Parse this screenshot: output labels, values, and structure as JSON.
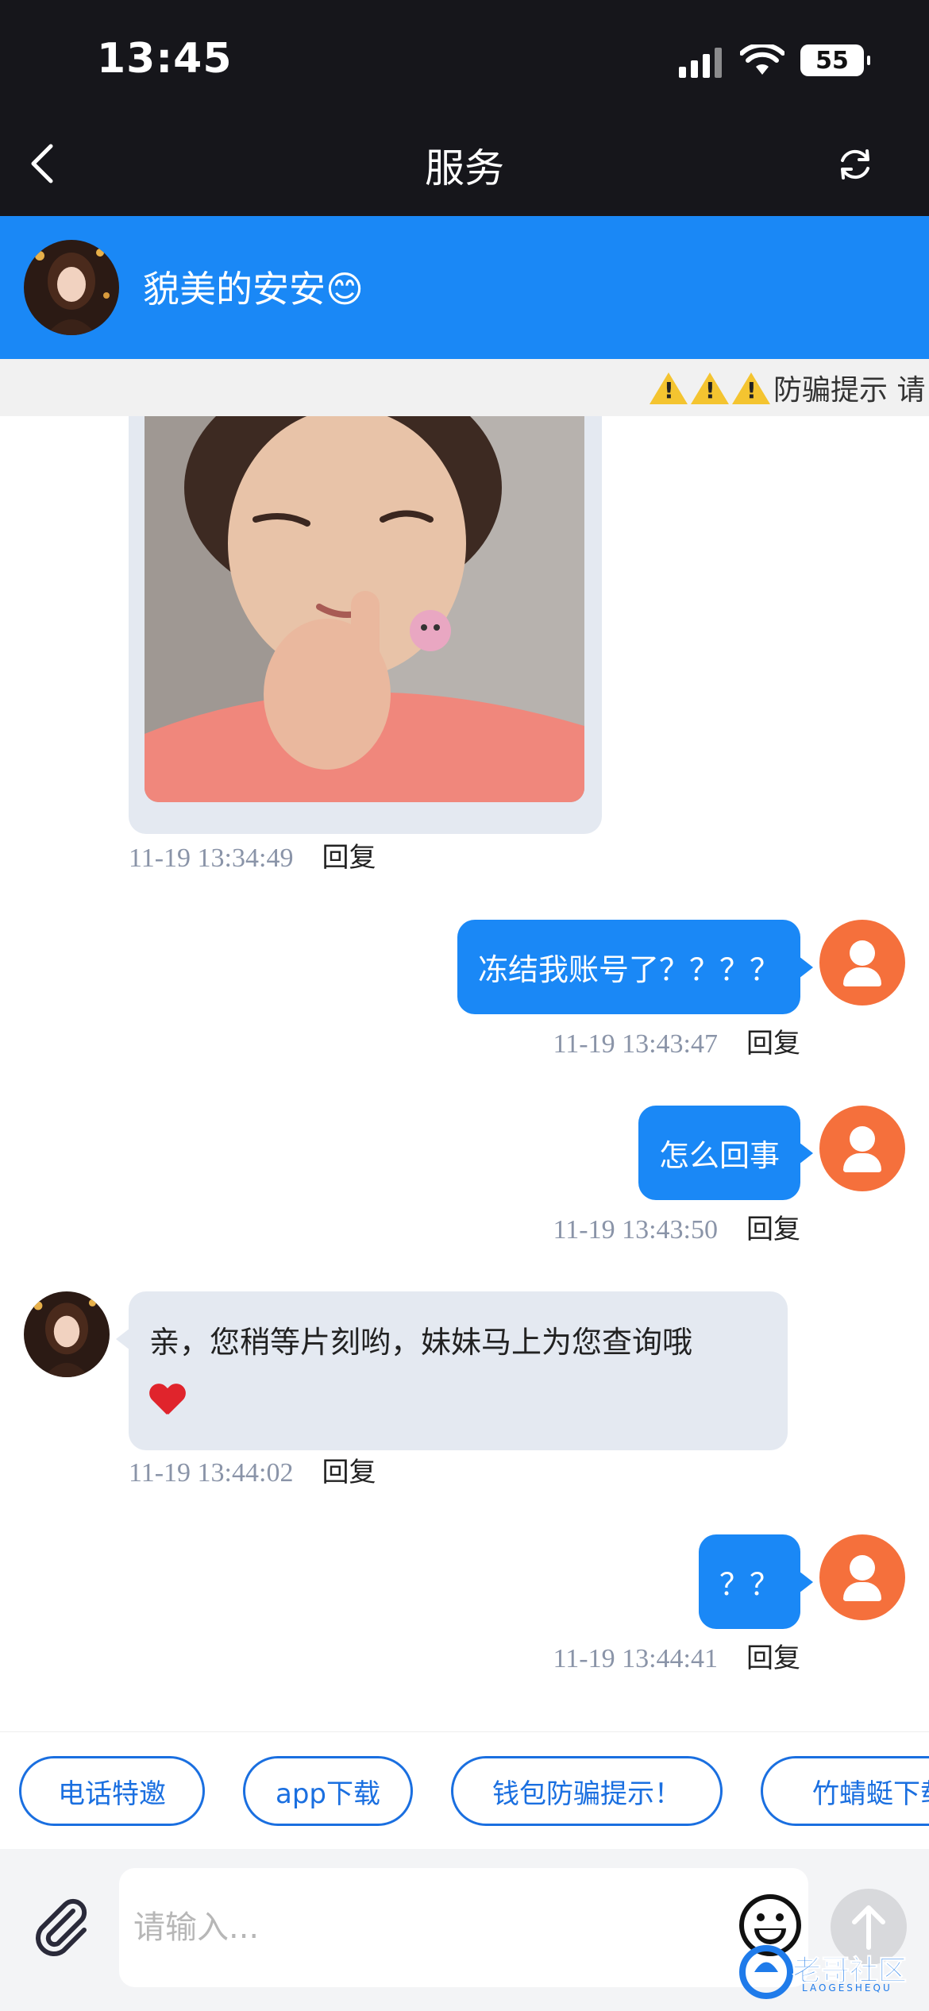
{
  "status_bar": {
    "time": "13:45",
    "battery": "55"
  },
  "nav": {
    "title": "服务"
  },
  "agent": {
    "name": "貌美的安安😊"
  },
  "notice": {
    "text": "防骗提示 请"
  },
  "messages": [
    {
      "type": "image",
      "side": "left",
      "time": "11-19 13:34:49",
      "reply": "回复"
    },
    {
      "type": "text",
      "side": "right",
      "text": "冻结我账号了？？？？",
      "time": "11-19 13:43:47",
      "reply": "回复"
    },
    {
      "type": "text",
      "side": "right",
      "text": "怎么回事",
      "time": "11-19 13:43:50",
      "reply": "回复"
    },
    {
      "type": "text",
      "side": "left",
      "text": "亲，您稍等片刻哟，妹妹马上为您查询哦",
      "time": "11-19 13:44:02",
      "reply": "回复"
    },
    {
      "type": "text",
      "side": "right",
      "text": "？？",
      "time": "11-19 13:44:41",
      "reply": "回复"
    }
  ],
  "quick_replies": [
    "电话特邀",
    "app下载",
    "钱包防骗提示！",
    "竹蜻蜓下载"
  ],
  "composer": {
    "placeholder": "请输入..."
  },
  "watermark": {
    "text": "老哥社区",
    "sub": "LAOGESHEQU"
  },
  "colors": {
    "brand_blue": "#1a88f6",
    "user_avatar": "#f5703c",
    "bubble_gray": "#e4e9f1"
  }
}
